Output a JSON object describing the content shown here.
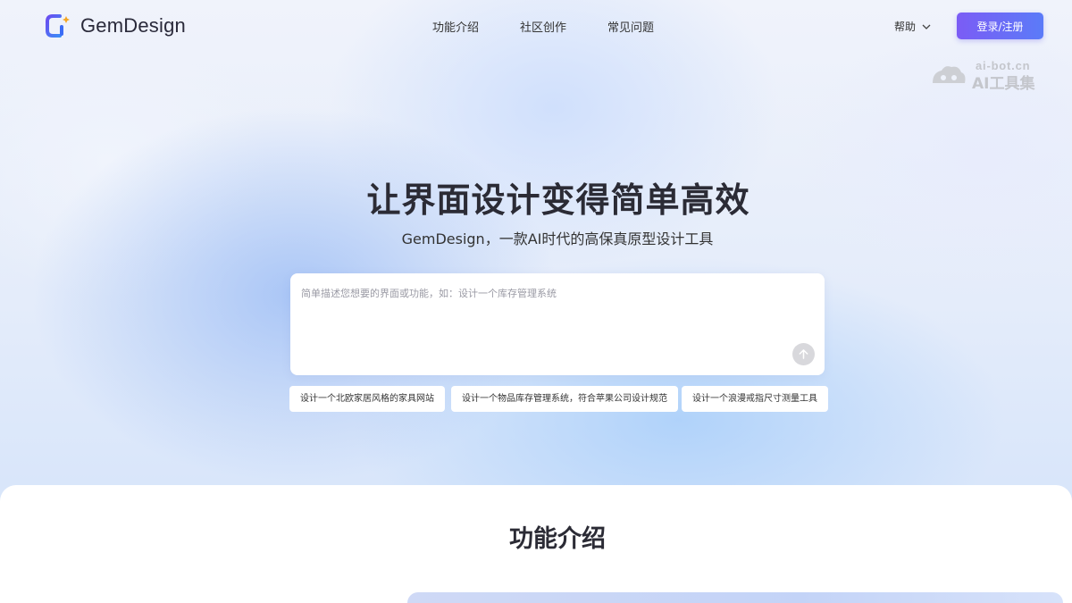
{
  "brand": {
    "name": "GemDesign"
  },
  "nav": {
    "items": [
      "功能介绍",
      "社区创作",
      "常见问题"
    ]
  },
  "header": {
    "help_label": "帮助",
    "login_label": "登录/注册"
  },
  "watermark": {
    "url": "ai-bot.cn",
    "name": "AI工具集"
  },
  "hero": {
    "title": "让界面设计变得简单高效",
    "subtitle": "GemDesign，一款AI时代的高保真原型设计工具"
  },
  "prompt": {
    "placeholder": "简单描述您想要的界面或功能，如：设计一个库存管理系统"
  },
  "suggestions": [
    "设计一个北欧家居风格的家具网站",
    "设计一个物品库存管理系统，符合苹果公司设计规范",
    "设计一个浪漫戒指尺寸测量工具"
  ],
  "features": {
    "title": "功能介绍"
  },
  "colors": {
    "accent_start": "#7b5cf5",
    "accent_end": "#5b7bf8",
    "logo_blue": "#3b6cf6",
    "logo_dot": "#f5a623"
  }
}
